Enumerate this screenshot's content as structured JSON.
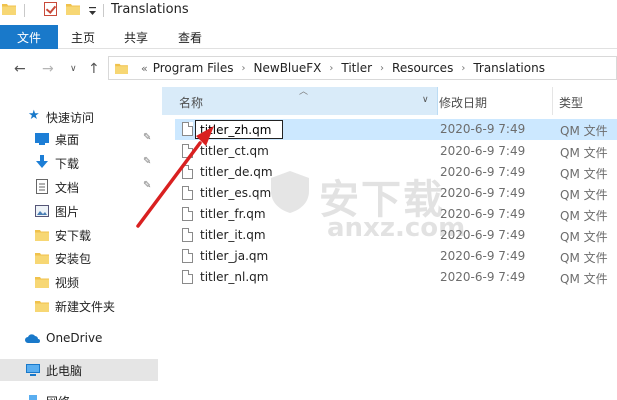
{
  "window": {
    "title": "Translations"
  },
  "ribbon": {
    "file_tab": "文件",
    "tabs": [
      "主页",
      "共享",
      "查看"
    ]
  },
  "address": {
    "overflow": "«",
    "breadcrumbs": [
      "Program Files",
      "NewBlueFX",
      "Titler",
      "Resources",
      "Translations"
    ]
  },
  "sidebar": {
    "quick_access": "快速访问",
    "items": [
      {
        "label": "桌面",
        "icon": "desktop-icon",
        "pinned": true
      },
      {
        "label": "下载",
        "icon": "download-icon",
        "pinned": true
      },
      {
        "label": "文档",
        "icon": "document-icon",
        "pinned": true
      },
      {
        "label": "图片",
        "icon": "picture-icon",
        "pinned": false
      },
      {
        "label": "安下载",
        "icon": "folder-icon",
        "pinned": false
      },
      {
        "label": "安装包",
        "icon": "folder-icon",
        "pinned": false
      },
      {
        "label": "视频",
        "icon": "folder-icon",
        "pinned": false
      },
      {
        "label": "新建文件夹",
        "icon": "folder-icon",
        "pinned": false
      }
    ],
    "onedrive": "OneDrive",
    "this_pc": "此电脑",
    "network": "网络"
  },
  "columns": {
    "name": "名称",
    "date": "修改日期",
    "type": "类型"
  },
  "files": [
    {
      "name": "titler_zh.qm",
      "date": "2020-6-9 7:49",
      "type": "QM 文件",
      "renaming": true
    },
    {
      "name": "titler_ct.qm",
      "date": "2020-6-9 7:49",
      "type": "QM 文件"
    },
    {
      "name": "titler_de.qm",
      "date": "2020-6-9 7:49",
      "type": "QM 文件"
    },
    {
      "name": "titler_es.qm",
      "date": "2020-6-9 7:49",
      "type": "QM 文件"
    },
    {
      "name": "titler_fr.qm",
      "date": "2020-6-9 7:49",
      "type": "QM 文件"
    },
    {
      "name": "titler_it.qm",
      "date": "2020-6-9 7:49",
      "type": "QM 文件"
    },
    {
      "name": "titler_ja.qm",
      "date": "2020-6-9 7:49",
      "type": "QM 文件"
    },
    {
      "name": "titler_nl.qm",
      "date": "2020-6-9 7:49",
      "type": "QM 文件"
    }
  ],
  "watermark": {
    "text": "安下载",
    "url": "anxz.com"
  },
  "colors": {
    "accent": "#1979ca",
    "selection": "#cce8ff",
    "folder": "#f0c24c",
    "annotation_arrow": "#d92020"
  }
}
